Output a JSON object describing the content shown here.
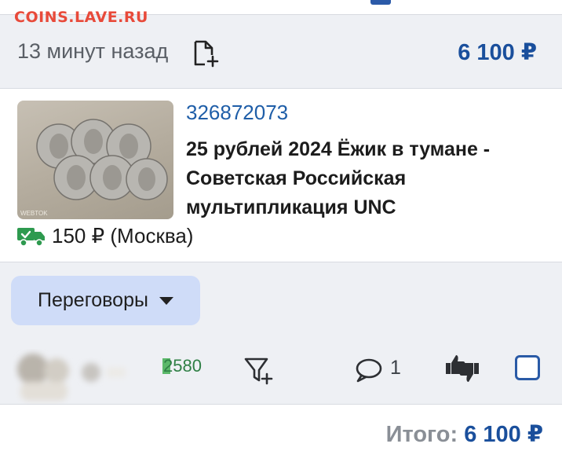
{
  "watermark": "COINS.LAVE.RU",
  "order": {
    "time_ago": "13 минут назад",
    "price": "6 100 ₽",
    "icons": {
      "note": "add-note-icon"
    }
  },
  "lot": {
    "id": "326872073",
    "title_lines": [
      "25 рублей 2024 Ёжик в тумане -",
      "Советская Российская",
      "мультипликация UNC"
    ],
    "shipping": "150 ₽ (Москва)",
    "image": "coins-photo",
    "image_watermark": "WEBTOK"
  },
  "status": {
    "label": "Переговоры",
    "icon": "caret-down-icon"
  },
  "seller": {
    "rating": "2580",
    "icons": {
      "avatar": "blurred-avatar",
      "filter": "filter-add-icon",
      "comment": "comment-icon",
      "thumbs": "thumbs-up-down-icon",
      "select": "checkbox"
    }
  },
  "comments": {
    "count": "1"
  },
  "total": {
    "label": "Итого:",
    "value": "6 100 ₽"
  },
  "colors": {
    "accent": "#1a4f9c",
    "band": "#eef0f4",
    "status_bg": "#cfdcf8",
    "shipping_green": "#2e9a4f",
    "watermark": "#e84a3a"
  }
}
